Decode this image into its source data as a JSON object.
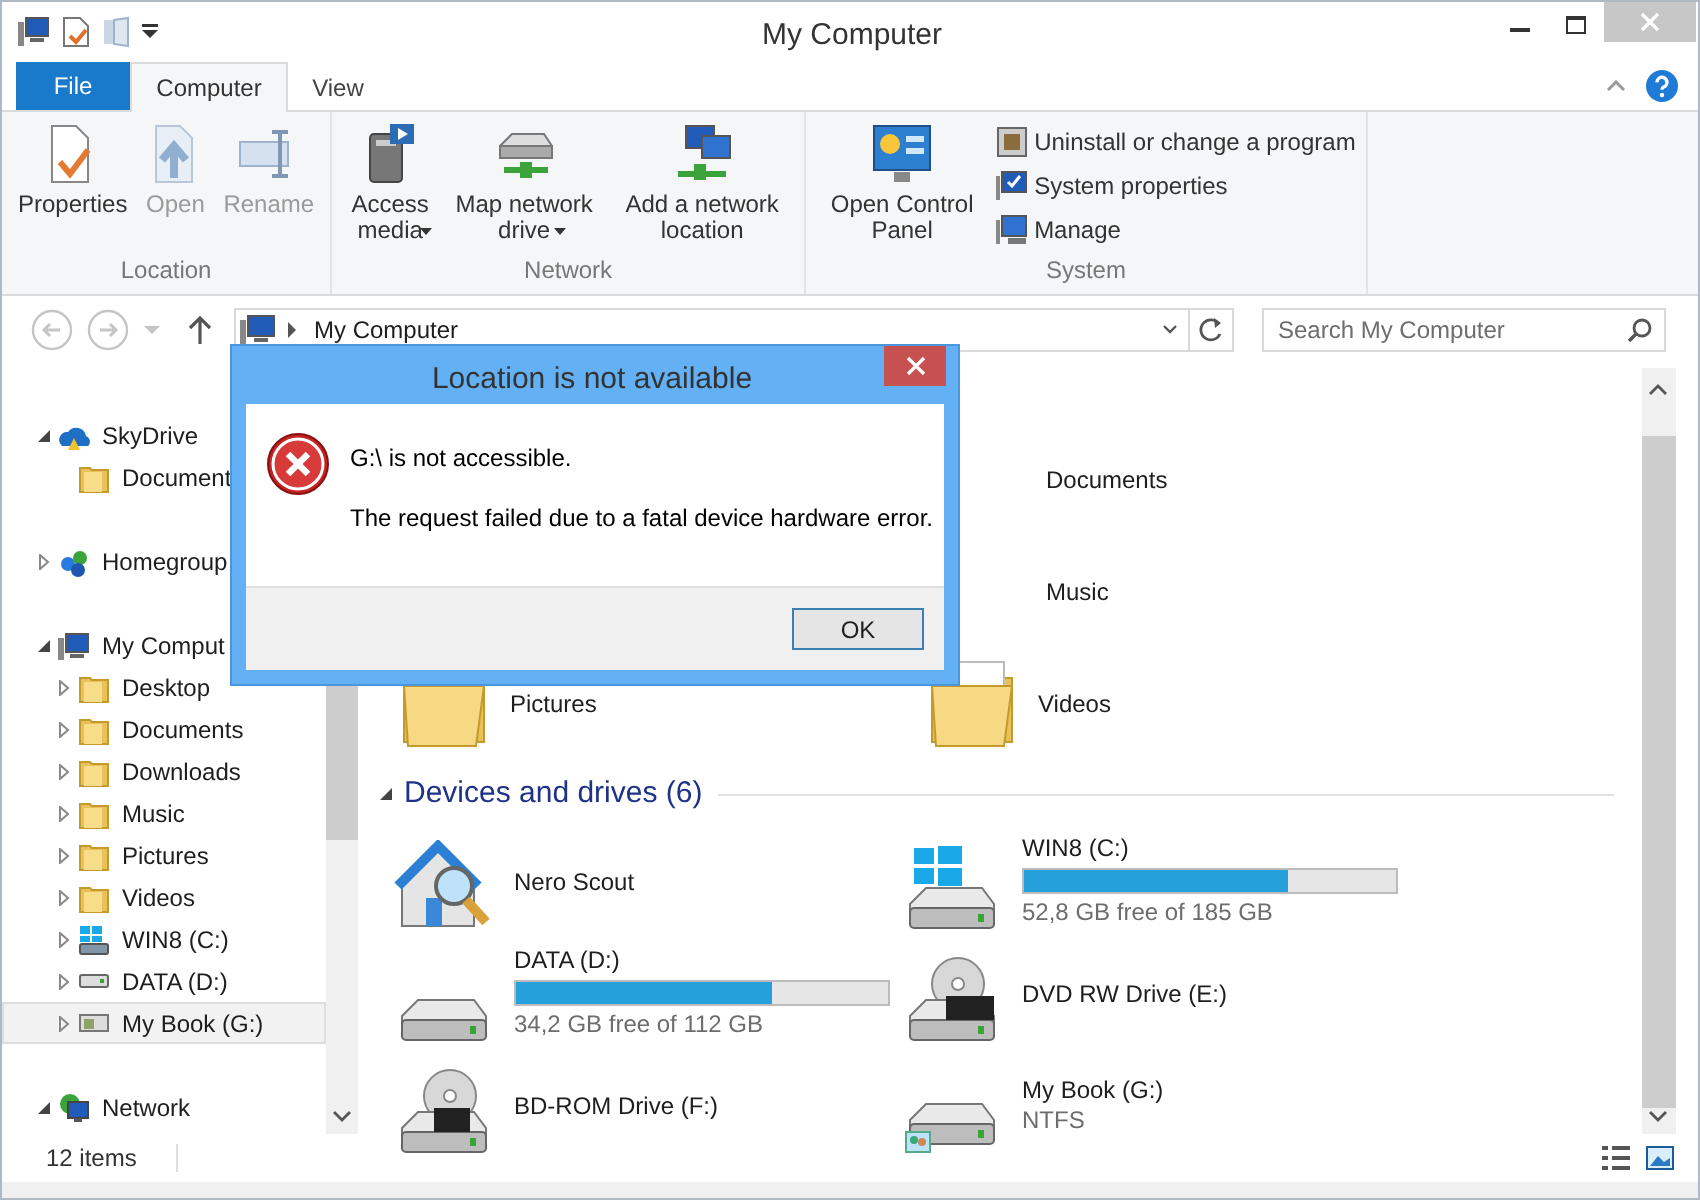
{
  "window": {
    "title": "My Computer"
  },
  "tabs": [
    {
      "label": "File",
      "kind": "file",
      "selected": false
    },
    {
      "label": "Computer",
      "kind": "tab",
      "selected": true
    },
    {
      "label": "View",
      "kind": "tab",
      "selected": false
    }
  ],
  "ribbon_groups": [
    {
      "label": "Location",
      "buttons": [
        {
          "label": "Properties",
          "disabled": false,
          "dropdown": false
        },
        {
          "label": "Open",
          "disabled": true,
          "dropdown": false
        },
        {
          "label": "Rename",
          "disabled": true,
          "dropdown": false
        }
      ]
    },
    {
      "label": "Network",
      "buttons": [
        {
          "label": "Access media",
          "disabled": false,
          "dropdown": true
        },
        {
          "label": "Map network drive",
          "disabled": false,
          "dropdown": true
        },
        {
          "label": "Add a network location",
          "disabled": false,
          "dropdown": false
        }
      ]
    },
    {
      "label": "System",
      "buttons": [
        {
          "label": "Open Control Panel",
          "disabled": false,
          "dropdown": false
        }
      ],
      "small_buttons": [
        {
          "label": "Uninstall or change a program"
        },
        {
          "label": "System properties"
        },
        {
          "label": "Manage"
        }
      ]
    }
  ],
  "address": {
    "path": "My Computer"
  },
  "search": {
    "placeholder": "Search My Computer"
  },
  "nav_tree": [
    {
      "label": "SkyDrive",
      "kind": "cloud",
      "expanded": true,
      "selected": false,
      "children": [
        {
          "label": "Document",
          "kind": "folder",
          "selected": false
        }
      ]
    },
    {
      "label": "Homegroup",
      "kind": "homegroup",
      "expanded": false,
      "selected": false
    },
    {
      "label": "My Comput",
      "kind": "computer",
      "expanded": true,
      "selected": false,
      "children": [
        {
          "label": "Desktop",
          "kind": "folder",
          "expanded": false,
          "selected": false
        },
        {
          "label": "Documents",
          "kind": "folder",
          "expanded": false,
          "selected": false
        },
        {
          "label": "Downloads",
          "kind": "folder",
          "expanded": false,
          "selected": false
        },
        {
          "label": "Music",
          "kind": "folder",
          "expanded": false,
          "selected": false
        },
        {
          "label": "Pictures",
          "kind": "folder",
          "expanded": false,
          "selected": false
        },
        {
          "label": "Videos",
          "kind": "folder",
          "expanded": false,
          "selected": false
        },
        {
          "label": "WIN8 (C:)",
          "kind": "windrive",
          "expanded": false,
          "selected": false
        },
        {
          "label": "DATA (D:)",
          "kind": "drive",
          "expanded": false,
          "selected": false
        },
        {
          "label": "My Book (G:)",
          "kind": "netdrive",
          "expanded": false,
          "selected": true
        }
      ]
    },
    {
      "label": "Network",
      "kind": "network",
      "expanded": true,
      "selected": false
    }
  ],
  "folders": [
    {
      "name": "Documents"
    },
    {
      "name": "Music"
    },
    {
      "name": "Pictures"
    },
    {
      "name": "Videos"
    }
  ],
  "devices": {
    "heading": "Devices and drives (6)",
    "expanded": true,
    "items": [
      {
        "name": "Nero Scout",
        "kind": "app"
      },
      {
        "name": "WIN8 (C:)",
        "kind": "windows",
        "level": 0.71,
        "free": "52,8 GB free of 185 GB"
      },
      {
        "name": "DATA (D:)",
        "kind": "hdd",
        "level": 0.69,
        "free": "34,2 GB free of 112 GB"
      },
      {
        "name": "DVD RW Drive (E:)",
        "kind": "dvd"
      },
      {
        "name": "BD-ROM Drive (F:)",
        "kind": "bd"
      },
      {
        "name": "My Book (G:)",
        "kind": "network",
        "fs": "NTFS"
      }
    ]
  },
  "status_bar": {
    "items": "12 items"
  },
  "dialog": {
    "title": "Location is not available",
    "message": "G:\\ is not accessible.",
    "detail": "The request failed due to a fatal device hardware error.",
    "button": "OK"
  }
}
